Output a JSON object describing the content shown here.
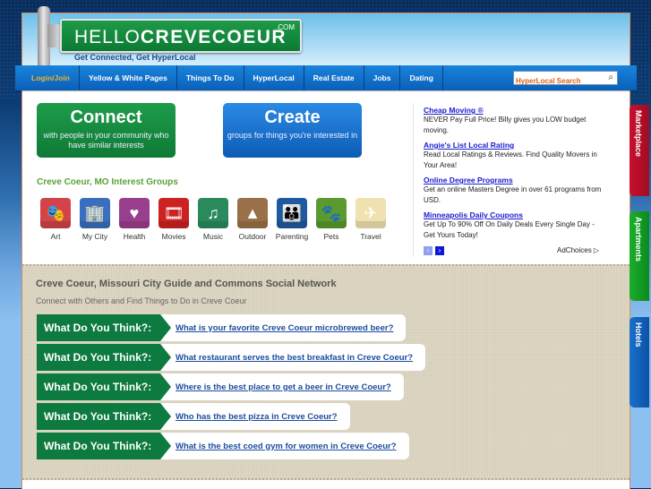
{
  "header": {
    "logo_light": "HELLO",
    "logo_bold": "CREVECOEUR",
    "logo_tld": ".COM",
    "tagline": "Get Connected, Get HyperLocal"
  },
  "nav": {
    "items": [
      {
        "label": "Login/Join"
      },
      {
        "label": "Yellow & White Pages"
      },
      {
        "label": "Things To Do"
      },
      {
        "label": "HyperLocal"
      },
      {
        "label": "Real Estate"
      },
      {
        "label": "Jobs"
      },
      {
        "label": "Dating"
      }
    ],
    "search_placeholder": "HyperLocal Search",
    "search_icon": "⌕"
  },
  "cta": {
    "connect": {
      "title": "Connect",
      "subtitle": "with people in your community who have similar interests"
    },
    "create": {
      "title": "Create",
      "subtitle": "groups for things you're interested in"
    }
  },
  "groups": {
    "title": "Creve Coeur, MO Interest Groups",
    "items": [
      {
        "label": "Art",
        "icon": "theater-masks-icon",
        "glyph": "🎭",
        "color": "#d2434a"
      },
      {
        "label": "My City",
        "icon": "city-buildings-icon",
        "glyph": "🏢",
        "color": "#3a6fc0"
      },
      {
        "label": "Health",
        "icon": "heart-pulse-icon",
        "glyph": "♥",
        "color": "#9a3e8e"
      },
      {
        "label": "Movies",
        "icon": "film-strip-icon",
        "glyph": "🎞",
        "color": "#cc2222"
      },
      {
        "label": "Music",
        "icon": "music-note-icon",
        "glyph": "♫",
        "color": "#2a8a5e"
      },
      {
        "label": "Outdoor",
        "icon": "pine-tree-icon",
        "glyph": "▲",
        "color": "#9a7048"
      },
      {
        "label": "Parenting",
        "icon": "family-icon",
        "glyph": "👪",
        "color": "#1e5aa0"
      },
      {
        "label": "Pets",
        "icon": "paw-print-icon",
        "glyph": "🐾",
        "color": "#5a9a2e"
      },
      {
        "label": "Travel",
        "icon": "airplane-icon",
        "glyph": "✈",
        "color": "#efe2b0"
      }
    ]
  },
  "ads": {
    "items": [
      {
        "title": "Cheap Moving ®",
        "text": "NEVER Pay Full Price! Billy gives you LOW budget moving."
      },
      {
        "title": "Angie's List Local Rating",
        "text": "Read Local Ratings & Reviews. Find Quality Movers in Your Area!"
      },
      {
        "title": "Online Degree Programs",
        "text": "Get an online Masters Degree in over 61 programs from USD."
      },
      {
        "title": "Minneapolis Daily Coupons",
        "text": "Get Up To 90% Off On Daily Deals Every Single Day - Get Yours Today!"
      }
    ],
    "prev": "‹",
    "next": "›",
    "adchoices": "AdChoices ▷"
  },
  "lower": {
    "title": "Creve Coeur, Missouri City Guide and Commons Social Network",
    "subtitle": "Connect with Others and Find Things to Do in Creve Coeur",
    "question_label": "What Do You Think?:",
    "questions": [
      "What is your favorite Creve Coeur microbrewed beer?",
      "What restaurant serves the best breakfast in Creve Coeur?",
      "Where is the best place to get a beer in Creve Coeur?",
      "Who has the best pizza in Creve Coeur?",
      "What is the best coed gym for women in Creve Coeur?"
    ]
  },
  "side_tabs": {
    "marketplace": "Marketplace",
    "apartments": "Apartments",
    "hotels": "Hotels"
  }
}
